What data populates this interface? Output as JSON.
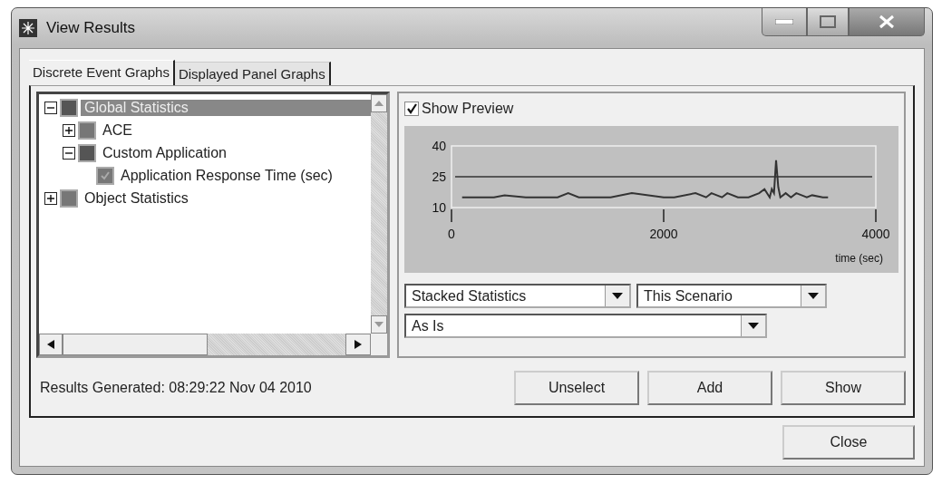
{
  "window": {
    "title": "View Results"
  },
  "tabs": [
    {
      "label": "Discrete Event Graphs",
      "selected": true
    },
    {
      "label": "Displayed Panel Graphs",
      "selected": false
    }
  ],
  "tree": [
    {
      "label": "Global Statistics",
      "expanded": true,
      "selected": true,
      "checked": false,
      "children": [
        {
          "label": "ACE",
          "expanded": false,
          "selected": false,
          "checked": false
        },
        {
          "label": "Custom Application",
          "expanded": true,
          "selected": false,
          "checked": false,
          "children": [
            {
              "label": "Application Response Time (sec)",
              "selected": false,
              "checked": true
            }
          ]
        }
      ]
    },
    {
      "label": "Object Statistics",
      "expanded": false,
      "selected": false,
      "checked": false
    }
  ],
  "preview": {
    "show_preview": {
      "label": "Show Preview",
      "checked": true
    },
    "chart_data": {
      "type": "line",
      "xlabel": "time (sec)",
      "xlim": [
        0,
        4000
      ],
      "ylim": [
        10,
        40
      ],
      "xticks": [
        0,
        2000,
        4000
      ],
      "yticks": [
        10,
        25,
        40
      ],
      "x": [
        100,
        400,
        500,
        700,
        1000,
        1100,
        1200,
        1500,
        1700,
        2000,
        2100,
        2300,
        2400,
        2450,
        2550,
        2600,
        2700,
        2800,
        2900,
        2950,
        3000,
        3020,
        3040,
        3060,
        3080,
        3100,
        3150,
        3200,
        3250,
        3300,
        3350,
        3400,
        3500,
        3550
      ],
      "series": [
        {
          "color": "#333333",
          "values": [
            15,
            15,
            16,
            15,
            15,
            17,
            15,
            15,
            17,
            15,
            15,
            17,
            15,
            17,
            15,
            17,
            15,
            15,
            17,
            19,
            15,
            19,
            17,
            33,
            20,
            15,
            17,
            15,
            17,
            16,
            15,
            16,
            15,
            15
          ]
        }
      ]
    }
  },
  "dropdowns": [
    {
      "value": "Stacked Statistics"
    },
    {
      "value": "This Scenario"
    },
    {
      "value": "As Is"
    }
  ],
  "status": "Results Generated: 08:29:22 Nov 04 2010",
  "buttons": [
    {
      "label": "Unselect"
    },
    {
      "label": "Add"
    },
    {
      "label": "Show"
    }
  ],
  "close_button": {
    "label": "Close"
  }
}
